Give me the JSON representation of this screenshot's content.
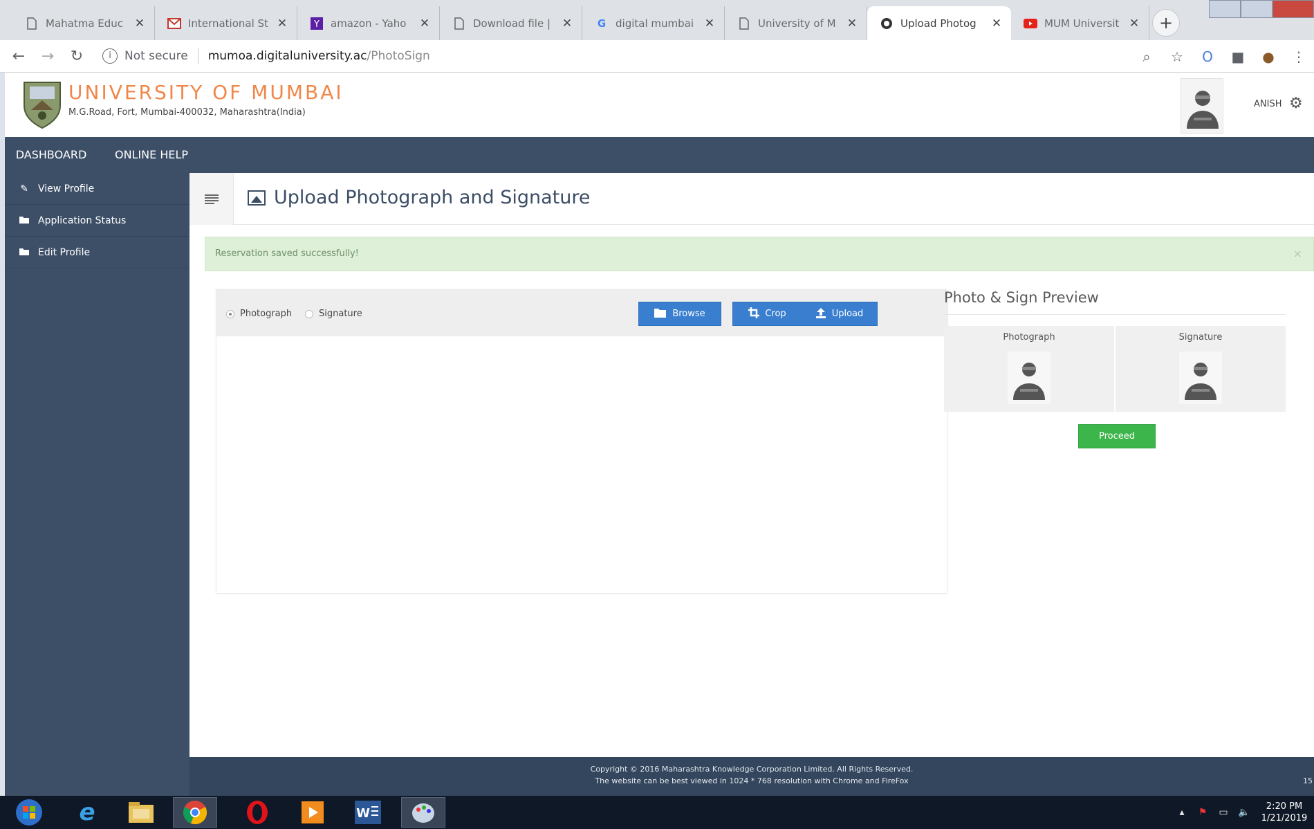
{
  "browser": {
    "tabs": [
      {
        "title": "Mahatma Educ",
        "icon": "page-icon"
      },
      {
        "title": "International St",
        "icon": "gmail-icon"
      },
      {
        "title": "amazon - Yaho",
        "icon": "yahoo-icon"
      },
      {
        "title": "Download file |",
        "icon": "page-icon"
      },
      {
        "title": "digital mumbai",
        "icon": "google-icon"
      },
      {
        "title": "University of M",
        "icon": "page-icon"
      },
      {
        "title": "Upload Photog",
        "icon": "site-icon"
      },
      {
        "title": "MUM Universit",
        "icon": "youtube-icon"
      }
    ],
    "active_tab_index": 6,
    "security_label": "Not secure",
    "url_host": "mumoa.digitaluniversity.ac",
    "url_path": "/PhotoSign"
  },
  "site": {
    "name": "UNIVERSITY OF MUMBAI",
    "address": "M.G.Road, Fort, Mumbai-400032, Maharashtra(India)",
    "user_name": "ANISH"
  },
  "nav": {
    "dashboard": "DASHBOARD",
    "online_help": "ONLINE HELP"
  },
  "sidebar": {
    "items": [
      {
        "label": "View Profile"
      },
      {
        "label": "Application Status"
      },
      {
        "label": "Edit Profile"
      }
    ]
  },
  "page": {
    "title": "Upload Photograph and Signature",
    "alert": "Reservation saved successfully!",
    "alert_close": "×"
  },
  "upload": {
    "radio_photograph": "Photograph",
    "radio_signature": "Signature",
    "selected": "Photograph",
    "browse_label": "Browse",
    "crop_label": "Crop",
    "upload_label": "Upload"
  },
  "preview": {
    "title": "Photo & Sign Preview",
    "photograph_label": "Photograph",
    "signature_label": "Signature",
    "proceed_label": "Proceed"
  },
  "footer": {
    "line1": "Copyright © 2016 Maharashtra Knowledge Corporation Limited. All Rights Reserved.",
    "line2": "The website can be best viewed in 1024 * 768 resolution with Chrome and FireFox",
    "edge_text": "15"
  },
  "taskbar": {
    "time": "2:20 PM",
    "date": "1/21/2019"
  },
  "colors": {
    "nav_bg": "#3d4f67",
    "brand_orange": "#f0874a",
    "button_blue": "#3a7fcf",
    "proceed_green": "#3cb54a",
    "alert_bg": "#dff0d8"
  }
}
